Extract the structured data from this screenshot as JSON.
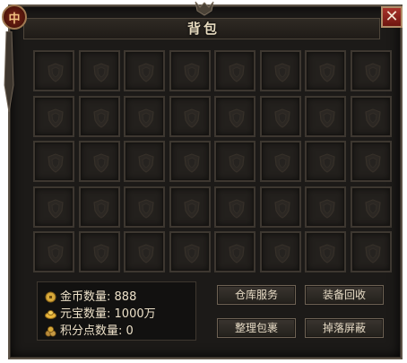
{
  "window": {
    "title": "背包",
    "close_glyph": "✕",
    "emblem_glyph": "中"
  },
  "inventory": {
    "columns": 8,
    "rows": 5,
    "slot_icon": "shield-icon"
  },
  "currency": {
    "gold": {
      "label": "金币数量",
      "value": "888",
      "icon": "gold-coin-icon",
      "color": "#d7a83a"
    },
    "yuanbao": {
      "label": "元宝数量",
      "value": "1000万",
      "icon": "yuanbao-icon",
      "color": "#e8b43a"
    },
    "points": {
      "label": "积分点数量",
      "value": "0",
      "icon": "points-icon",
      "color": "#b88a3a"
    }
  },
  "buttons": {
    "warehouse": "仓库服务",
    "recycle": "装备回收",
    "sort": "整理包裹",
    "drop_filter": "掉落屏蔽"
  },
  "colors": {
    "panel_bg": "#1c1a18",
    "border": "#5c5246",
    "text": "#e6dac4",
    "close_red": "#a8332a"
  }
}
